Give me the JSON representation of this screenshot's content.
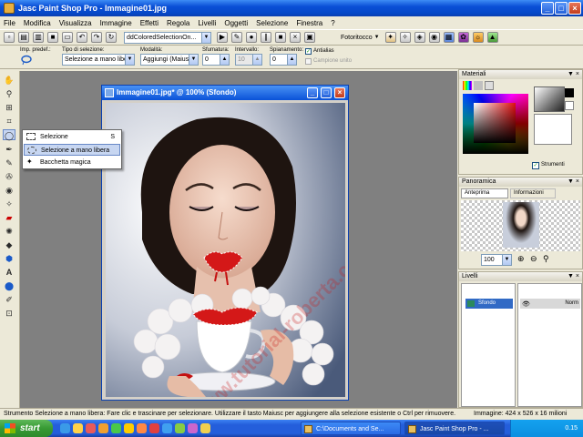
{
  "window": {
    "title": "Jasc Paint Shop Pro - Immagine01.jpg"
  },
  "menu": [
    "File",
    "Modifica",
    "Visualizza",
    "Immagine",
    "Effetti",
    "Regola",
    "Livelli",
    "Oggetti",
    "Selezione",
    "Finestra",
    "?"
  ],
  "toolbar": {
    "dropdown_value": "ddColoredSelectionOn...",
    "mode_value": "Fotoritocco"
  },
  "tool_options": {
    "preset_label": "Imp. predef.:",
    "selection_type_label": "Tipo di selezione:",
    "selection_type_value": "Selezione a mano libera",
    "mode_label": "Modalità:",
    "mode_value": "Aggiungi (Maiusc)",
    "feather_label": "Sfumatura:",
    "feather_value": "0",
    "range_label": "Intervallo:",
    "range_value": "10",
    "smoothing_label": "Spianamento:",
    "smoothing_value": "0",
    "antialias_label": "Antialias",
    "antialias_checked": true,
    "sample_merged_label": "Campione unito"
  },
  "flyout": {
    "items": [
      {
        "label": "Selezione",
        "shortcut": "S"
      },
      {
        "label": "Selezione a mano libera",
        "shortcut": ""
      },
      {
        "label": "Bacchetta magica",
        "shortcut": ""
      }
    ]
  },
  "document": {
    "title": "Immagine01.jpg* @ 100% (Sfondo)"
  },
  "panels": {
    "materials": {
      "title": "Materiali",
      "strumenti_label": "Strumenti"
    },
    "overview": {
      "title": "Panoramica",
      "tab_preview": "Anteprima",
      "tab_info": "Informazioni",
      "zoom_value": "100"
    },
    "layers": {
      "title": "Livelli",
      "layer_name": "Sfondo",
      "col_normal": "Norm"
    }
  },
  "watermark": "www.tutorial-roberta.com",
  "status": {
    "message": "Strumento Selezione a mano libera: Fare clic e trascinare per selezionare. Utilizzare il tasto Maiusc per aggiungere alla selezione esistente o Ctrl per rimuovere.",
    "image_info": "Immagine:  424 x 526 x 16 milioni"
  },
  "taskbar": {
    "start_label": "start",
    "items": [
      "C:\\Documents and Se...",
      "Jasc Paint Shop Pro - ..."
    ],
    "clock": "0.15"
  },
  "colors": {
    "accent": "#0a52d8",
    "selection_red": "#d42020"
  }
}
